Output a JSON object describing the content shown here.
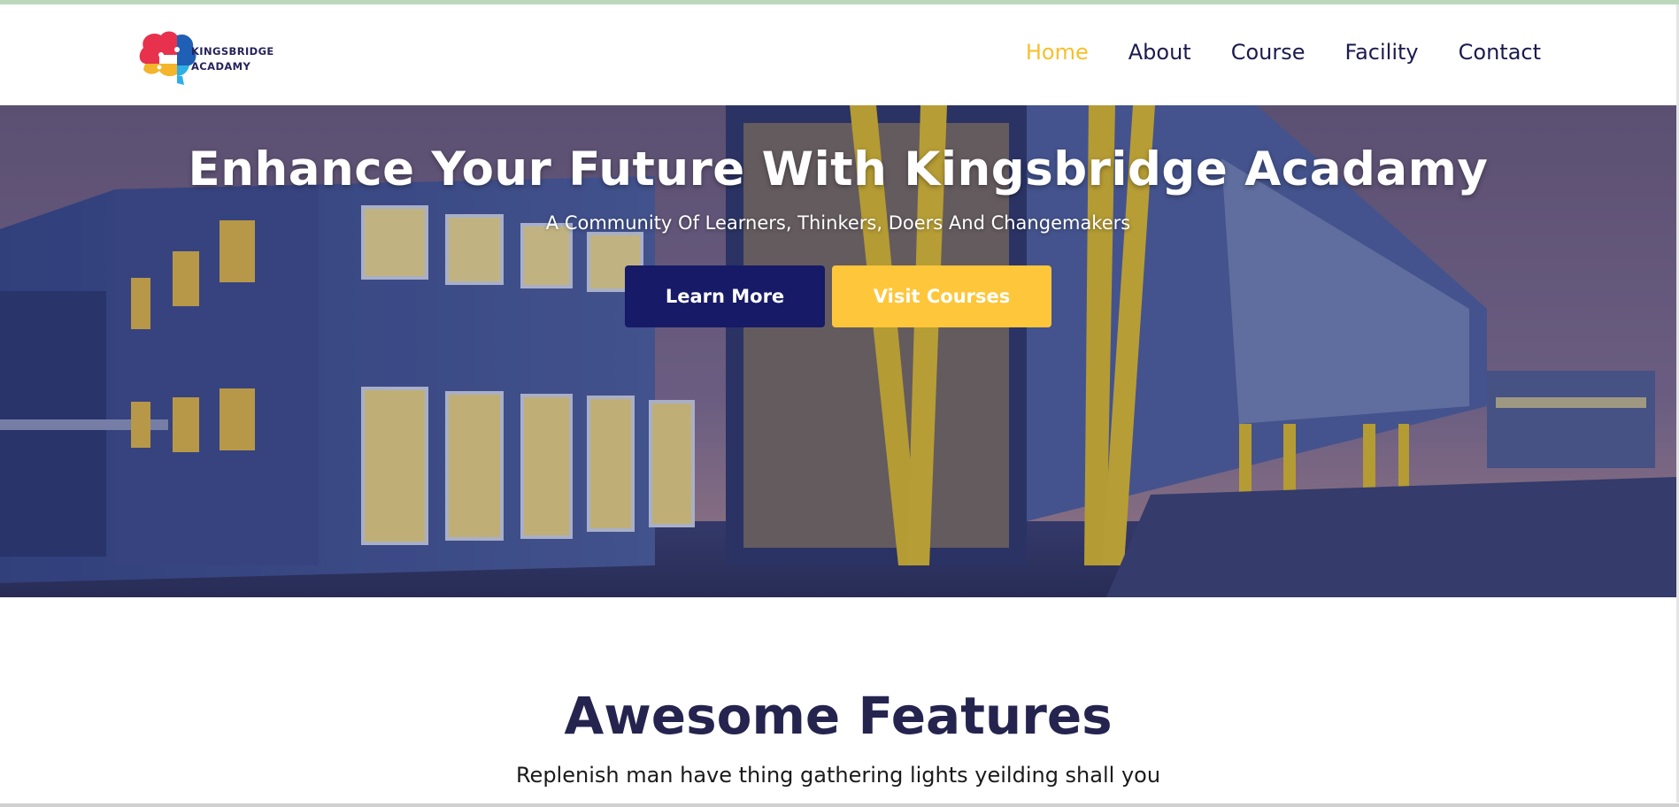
{
  "brand": {
    "line1": "KINGSBRIDGE",
    "line2": "ACADAMY",
    "logo_colors": [
      "#e8314c",
      "#1f5fb5",
      "#f4b42b",
      "#2eb0e6"
    ]
  },
  "nav": {
    "items": [
      {
        "label": "Home",
        "active": true
      },
      {
        "label": "About",
        "active": false
      },
      {
        "label": "Course",
        "active": false
      },
      {
        "label": "Facility",
        "active": false
      },
      {
        "label": "Contact",
        "active": false
      }
    ],
    "active_color": "#f8bf2c",
    "link_color": "#1b1b4f"
  },
  "hero": {
    "title": "Enhance Your Future With Kingsbridge Acadamy",
    "subtitle": "A Community Of Learners, Thinkers, Doers And Changemakers",
    "primary_button": "Learn More",
    "secondary_button": "Visit Courses",
    "primary_color": "#171a66",
    "secondary_color": "#fec63a",
    "background_image": "school-building-photo"
  },
  "features": {
    "title": "Awesome Features",
    "subtitle": "Replenish man have thing gathering lights yeilding shall you"
  }
}
